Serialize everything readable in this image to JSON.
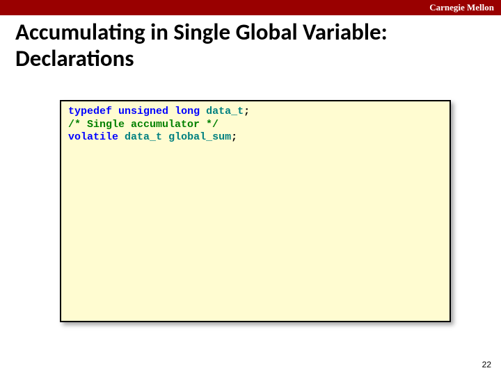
{
  "header": {
    "institution": "Carnegie Mellon"
  },
  "slide": {
    "title": "Accumulating in Single Global Variable: Declarations",
    "page_number": "22"
  },
  "code": {
    "l1_kw1": "typedef",
    "l1_kw2": "unsigned",
    "l1_kw3": "long",
    "l1_type": "data_t",
    "l1_semi": ";",
    "l2_comment": "/* Single accumulator */",
    "l3_kw1": "volatile",
    "l3_type": "data_t",
    "l3_ident": "global_sum",
    "l3_semi": ";"
  }
}
